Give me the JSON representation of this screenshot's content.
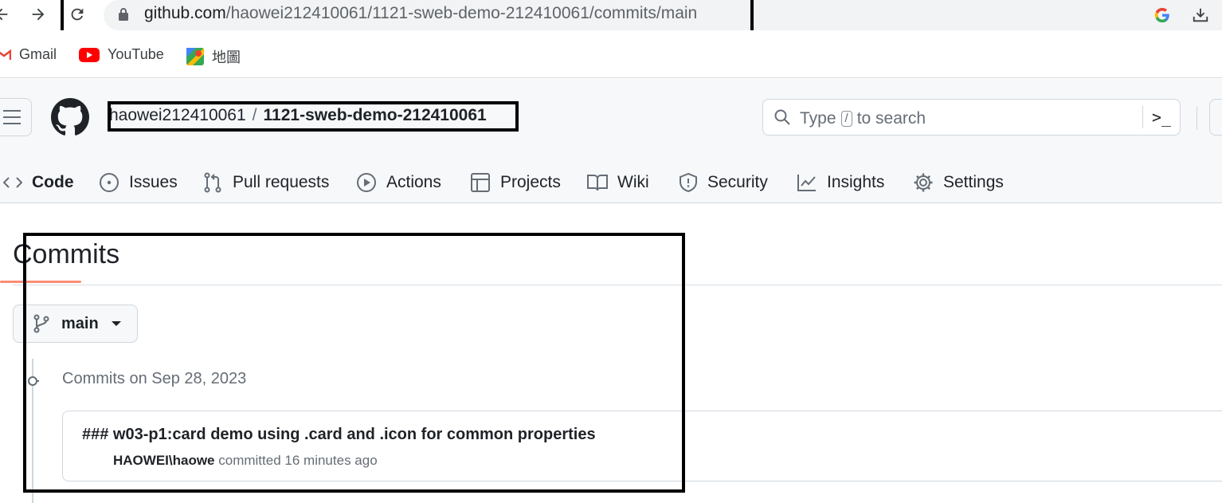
{
  "browser": {
    "url_host": "github.com",
    "url_path": "/haowei212410061/1121-sweb-demo-212410061/commits/main"
  },
  "bookmarks": [
    {
      "label": "Gmail",
      "icon": "gmail-icon"
    },
    {
      "label": "YouTube",
      "icon": "youtube-icon"
    },
    {
      "label": "地圖",
      "icon": "maps-icon"
    }
  ],
  "header": {
    "owner": "haowei212410061",
    "separator": "/",
    "repo": "1121-sweb-demo-212410061",
    "search_prefix": "Type",
    "search_key": "/",
    "search_suffix": "to search"
  },
  "tabs": [
    {
      "label": "Code",
      "icon": "code-icon",
      "active": true
    },
    {
      "label": "Issues",
      "icon": "issue-icon"
    },
    {
      "label": "Pull requests",
      "icon": "pull-request-icon"
    },
    {
      "label": "Actions",
      "icon": "play-icon"
    },
    {
      "label": "Projects",
      "icon": "table-icon"
    },
    {
      "label": "Wiki",
      "icon": "book-icon"
    },
    {
      "label": "Security",
      "icon": "shield-icon"
    },
    {
      "label": "Insights",
      "icon": "graph-icon"
    },
    {
      "label": "Settings",
      "icon": "gear-icon"
    }
  ],
  "main": {
    "title": "Commits",
    "branch": "main",
    "group_label": "Commits on Sep 28, 2023",
    "commits": [
      {
        "message": "### w03-p1:card demo using .card and .icon for common properties",
        "author": "HAOWEI\\haowe",
        "action": "committed",
        "time": "16 minutes ago"
      }
    ]
  },
  "colors": {
    "tab_underline": "#fd8c73",
    "header_bg": "#f6f8fa",
    "muted_text": "#656d76",
    "border": "#d0d7de"
  }
}
